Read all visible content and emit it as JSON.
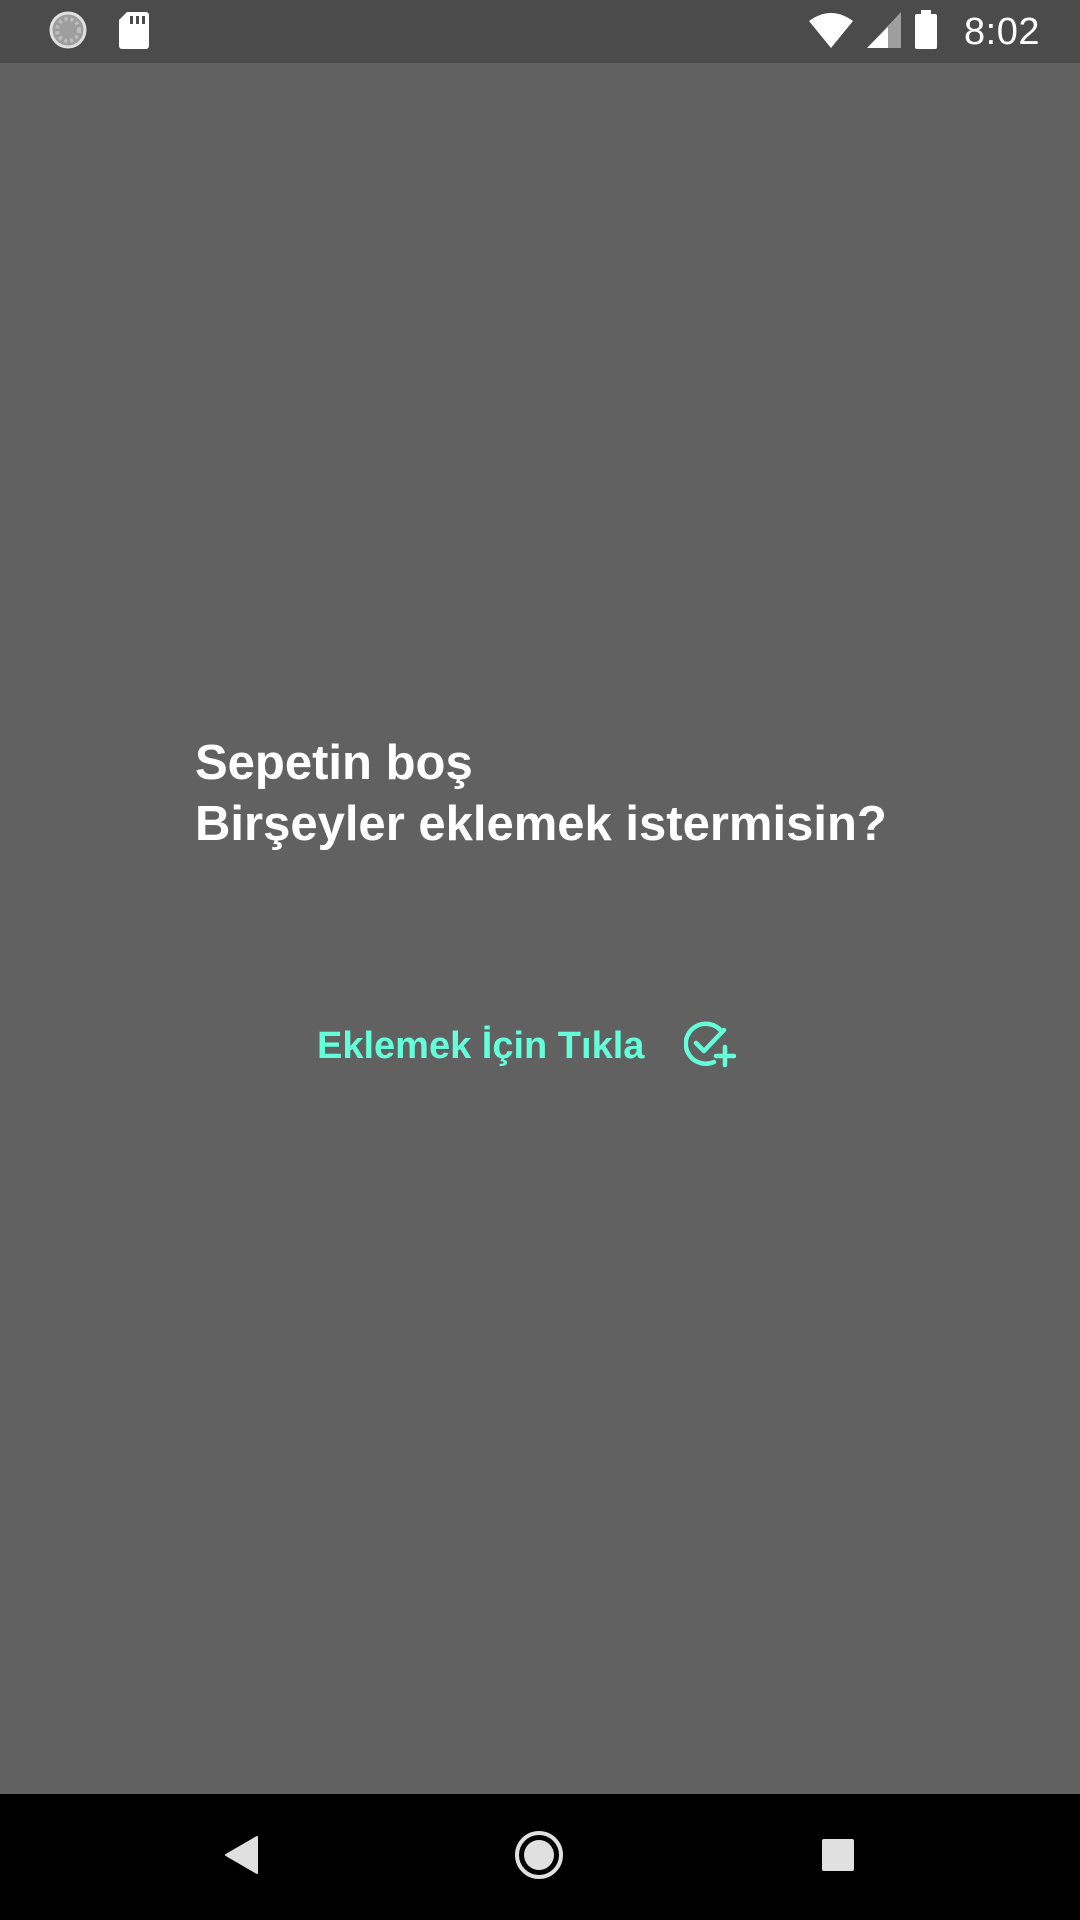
{
  "status_bar": {
    "time": "8:02",
    "icons": [
      "loading-icon",
      "sd-card-icon",
      "wifi-icon",
      "signal-icon",
      "battery-icon"
    ]
  },
  "cart": {
    "empty_title": "Sepetin boş",
    "empty_subtitle": "Birşeyler eklemek istermisin?",
    "add_label": "Eklemek İçin Tıkla",
    "add_icon": "check-circle-plus-icon"
  },
  "nav_bar": {
    "icons": [
      "back-icon",
      "home-icon",
      "recents-icon"
    ]
  },
  "colors": {
    "background": "#616161",
    "status_bar": "#4b4b4b",
    "accent": "#64ffda",
    "nav_bar": "#000000"
  }
}
